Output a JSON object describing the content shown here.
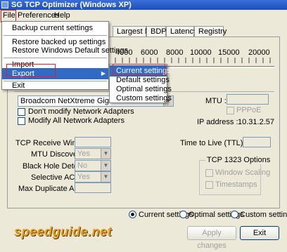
{
  "window": {
    "title": "SG TCP Optimizer (Windows XP)"
  },
  "menubar": {
    "file": "File",
    "preferences": "Preferences",
    "help": "Help"
  },
  "tabs": [
    "Largest MTU",
    "BDP",
    "Latency",
    "Registry"
  ],
  "slider": {
    "labels": [
      "4000",
      "6000",
      "8000",
      "10000",
      "15000",
      "20000"
    ]
  },
  "adapter": {
    "combo_value": "Broadcom NetXtreme Gigabit Ether",
    "dont_modify": "Don't modify Network Adapters",
    "modify_all": "Modify All Network Adapters",
    "mtu_label": "MTU :",
    "pppoe_label": "PPPoE",
    "ip_label": "IP address :",
    "ip_value": "10.31.2.57"
  },
  "settings": {
    "tcp_receive_window": "TCP Receive Window :",
    "mtu_discovery": "MTU Discovery :",
    "mtu_discovery_value": "Yes",
    "black_hole_detect": "Black Hole Detect :",
    "black_hole_detect_value": "No",
    "selective_acks": "Selective ACKs :",
    "selective_acks_value": "Yes",
    "max_duplicate_acks": "Max Duplicate ACKs :",
    "ttl_label": "Time to Live (TTL) :"
  },
  "tcp1323": {
    "title": "TCP 1323 Options",
    "window_scaling": "Window Scaling",
    "timestamps": "Timestamps"
  },
  "bottom": {
    "radio_current": "Current settings",
    "radio_optimal": "Optimal settings",
    "radio_custom": "Custom settings",
    "apply": "Apply changes",
    "exit": "Exit",
    "logo": "speedguide.net"
  },
  "file_menu": {
    "items": [
      "Backup current settings",
      "Restore backed up settings",
      "Restore Windows Default settings",
      "Import",
      "Export",
      "Exit"
    ]
  },
  "export_submenu": {
    "items": [
      "Current settings",
      "Default settings",
      "Optimal settings",
      "Custom settings"
    ]
  },
  "colors": {
    "titlebar": "#1f4fb8",
    "highlight": "#316ac5",
    "annotation": "#e0202a",
    "logo": "#e7a11c"
  }
}
